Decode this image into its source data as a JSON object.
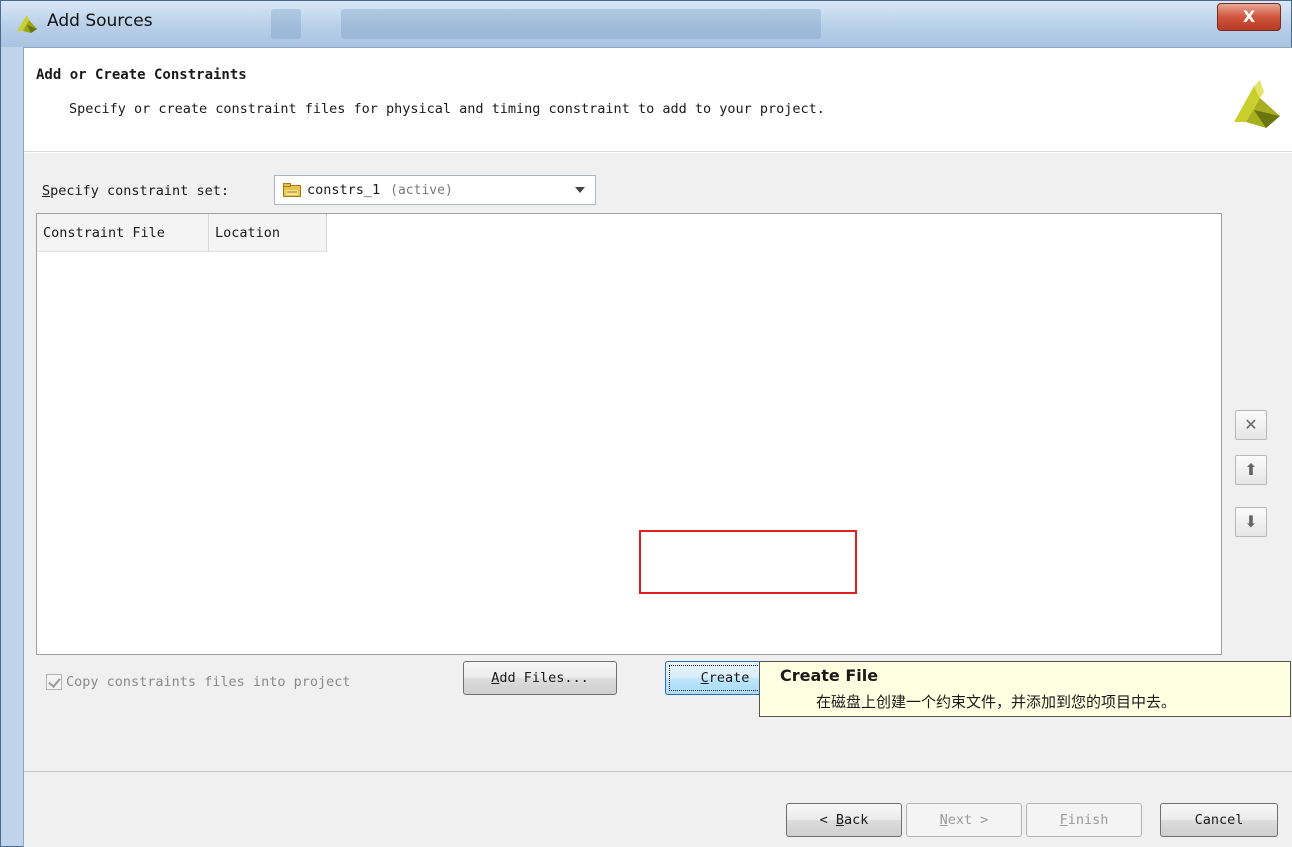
{
  "window": {
    "title": "Add Sources",
    "close_label": "X"
  },
  "header": {
    "title": "Add or Create Constraints",
    "description": "Specify or create constraint files for physical and timing constraint to add to your project."
  },
  "constraint_set": {
    "label_mnemonic": "S",
    "label_rest": "pecify constraint set:",
    "value": "constrs_1",
    "status": "(active)"
  },
  "table": {
    "columns": [
      "Constraint File",
      "Location"
    ]
  },
  "side_buttons": {
    "remove": "✕",
    "move_up": "⬆",
    "move_down": "⬇"
  },
  "actions": {
    "add_files": {
      "mnemonic": "A",
      "rest": "dd Files..."
    },
    "create_file": {
      "mnemonic": "C",
      "rest": "reate File..."
    }
  },
  "copy_option": {
    "label": "Copy constraints files into project",
    "checked": true
  },
  "tooltip": {
    "title": "Create File",
    "text": "在磁盘上创建一个约束文件，并添加到您的项目中去。"
  },
  "footer": {
    "back": {
      "prefix": "< ",
      "mnemonic": "B",
      "rest": "ack"
    },
    "next": {
      "mnemonic": "N",
      "rest": "ext >"
    },
    "finish": {
      "mnemonic": "F",
      "rest": "inish"
    },
    "cancel": "Cancel"
  },
  "colors": {
    "highlight": "#e02020",
    "logo_yellow": "#c9cf2c",
    "tooltip_bg": "#ffffe1"
  }
}
